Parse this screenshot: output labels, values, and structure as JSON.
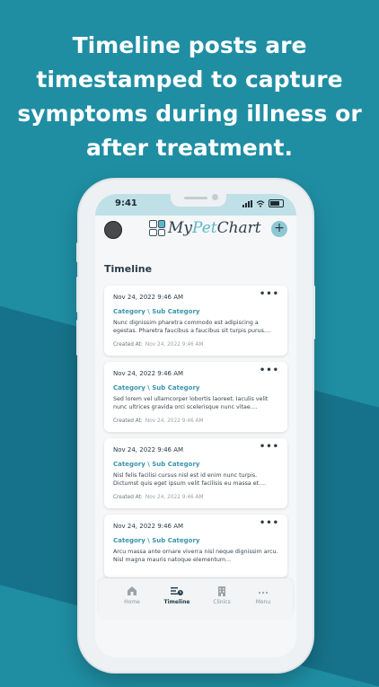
{
  "headline": {
    "lines": [
      "Timeline posts are",
      "timestamped to capture",
      "symptoms during illness or",
      "after treatment."
    ]
  },
  "statusbar": {
    "time": "9:41"
  },
  "appbar": {
    "logo_text_my": "My",
    "logo_text_pet": "Pet",
    "logo_text_chart": "Chart",
    "add_label": "+"
  },
  "timeline": {
    "title": "Timeline",
    "created_label": "Created At:",
    "more_label": "•••",
    "cards": [
      {
        "date": "Nov 24, 2022 9:46 AM",
        "category": "Category \\ Sub Category",
        "body": "Nunc dignissim pharetra commodo est adipiscing a egestas. Pharetra faucibus a faucibus sit turpis purus....",
        "created_at": "Nov 24, 2022 9:46 AM"
      },
      {
        "date": "Nov 24, 2022 9:46 AM",
        "category": "Category \\ Sub Category",
        "body": "Sed lorem vel ullamcorper lobortis laoreet. Iaculis velit nunc ultrices gravida orci scelerisque nunc vitae....",
        "created_at": "Nov 24, 2022 9:46 AM"
      },
      {
        "date": "Nov 24, 2022 9:46 AM",
        "category": "Category \\ Sub Category",
        "body": "Nisl felis facilisi cursus nisl est id enim nunc turpis. Dictumst quis eget ipsum velit facilisis eu massa et....",
        "created_at": "Nov 24, 2022 9:46 AM"
      },
      {
        "date": "Nov 24, 2022 9:46 AM",
        "category": "Category \\ Sub Category",
        "body": "Arcu massa ante ornare viverra nisl neque dignissim arcu. Nisl magna mauris natoque elementum...",
        "created_at": ""
      }
    ]
  },
  "tabbar": {
    "tabs": [
      {
        "label": "Home",
        "icon": "home-icon",
        "active": false
      },
      {
        "label": "Timeline",
        "icon": "timeline-icon",
        "active": true
      },
      {
        "label": "Clinics",
        "icon": "clinic-building-icon",
        "active": false
      },
      {
        "label": "Menu",
        "icon": "more-dots-icon",
        "active": false
      }
    ]
  },
  "colors": {
    "background": "#1f8ea3",
    "accent": "#3a95ac",
    "statusbar": "#bfe0e6"
  }
}
